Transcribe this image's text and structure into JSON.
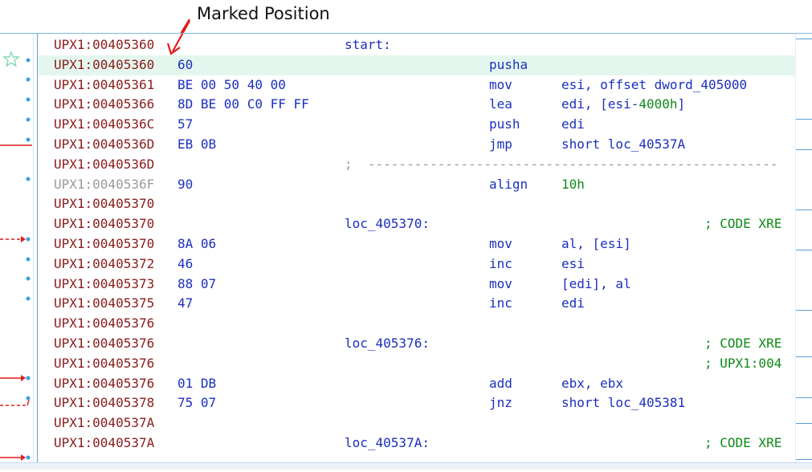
{
  "annotation": {
    "text": "Marked Position"
  },
  "rows": [
    {
      "addr": "UPX1:00405360",
      "bytes": "",
      "label": "start:",
      "mnem": "",
      "ops": "",
      "ops_num": "",
      "comment": ""
    },
    {
      "addr": "UPX1:00405360",
      "bytes": "60",
      "label": "",
      "mnem": "pusha",
      "ops": "",
      "ops_num": "",
      "comment": ""
    },
    {
      "addr": "UPX1:00405361",
      "bytes": "BE 00 50 40 00",
      "label": "",
      "mnem": "mov",
      "ops": "esi, offset dword_405000",
      "ops_num": "",
      "comment": ""
    },
    {
      "addr": "UPX1:00405366",
      "bytes": "8D BE 00 C0 FF FF",
      "label": "",
      "mnem": "lea",
      "ops": "edi, [esi-",
      "ops_num": "4000h",
      "ops_tail": "]",
      "comment": ""
    },
    {
      "addr": "UPX1:0040536C",
      "bytes": "57",
      "label": "",
      "mnem": "push",
      "ops": "edi",
      "ops_num": "",
      "comment": ""
    },
    {
      "addr": "UPX1:0040536D",
      "bytes": "EB 0B",
      "label": "",
      "mnem": "jmp",
      "ops": "short loc_40537A",
      "ops_num": "",
      "comment": ""
    },
    {
      "addr": "UPX1:0040536D",
      "bytes": "",
      "label": "",
      "mnem": "",
      "ops": "",
      "ops_num": "",
      "comment": "",
      "separator": ";  -----------------------------------------------------"
    },
    {
      "addr": "UPX1:0040536F",
      "bytes": "90",
      "label": "",
      "mnem": "align",
      "ops": "",
      "ops_num": "10h",
      "comment": "",
      "dim": true
    },
    {
      "addr": "UPX1:00405370",
      "bytes": "",
      "label": "",
      "mnem": "",
      "ops": "",
      "ops_num": "",
      "comment": ""
    },
    {
      "addr": "UPX1:00405370",
      "bytes": "",
      "label": "loc_405370:",
      "mnem": "",
      "ops": "",
      "ops_num": "",
      "comment": "; CODE XRE"
    },
    {
      "addr": "UPX1:00405370",
      "bytes": "8A 06",
      "label": "",
      "mnem": "mov",
      "ops": "al, [esi]",
      "ops_num": "",
      "comment": ""
    },
    {
      "addr": "UPX1:00405372",
      "bytes": "46",
      "label": "",
      "mnem": "inc",
      "ops": "esi",
      "ops_num": "",
      "comment": ""
    },
    {
      "addr": "UPX1:00405373",
      "bytes": "88 07",
      "label": "",
      "mnem": "mov",
      "ops": "[edi], al",
      "ops_num": "",
      "comment": ""
    },
    {
      "addr": "UPX1:00405375",
      "bytes": "47",
      "label": "",
      "mnem": "inc",
      "ops": "edi",
      "ops_num": "",
      "comment": ""
    },
    {
      "addr": "UPX1:00405376",
      "bytes": "",
      "label": "",
      "mnem": "",
      "ops": "",
      "ops_num": "",
      "comment": ""
    },
    {
      "addr": "UPX1:00405376",
      "bytes": "",
      "label": "loc_405376:",
      "mnem": "",
      "ops": "",
      "ops_num": "",
      "comment": "; CODE XRE"
    },
    {
      "addr": "UPX1:00405376",
      "bytes": "",
      "label": "",
      "mnem": "",
      "ops": "",
      "ops_num": "",
      "comment": "; UPX1:004"
    },
    {
      "addr": "UPX1:00405376",
      "bytes": "01 DB",
      "label": "",
      "mnem": "add",
      "ops": "ebx, ebx",
      "ops_num": "",
      "comment": ""
    },
    {
      "addr": "UPX1:00405378",
      "bytes": "75 07",
      "label": "",
      "mnem": "jnz",
      "ops": "short loc_405381",
      "ops_num": "",
      "comment": ""
    },
    {
      "addr": "UPX1:0040537A",
      "bytes": "",
      "label": "",
      "mnem": "",
      "ops": "",
      "ops_num": "",
      "comment": ""
    },
    {
      "addr": "UPX1:0040537A",
      "bytes": "",
      "label": "loc_40537A:",
      "mnem": "",
      "ops": "",
      "ops_num": "",
      "comment": "; CODE XRE"
    }
  ],
  "colors": {
    "address": "#8b1a1a",
    "code": "#1a2fbf",
    "number": "#0e8a16",
    "highlight": "#e4f7ee",
    "arrow_red": "#e01b1b"
  }
}
